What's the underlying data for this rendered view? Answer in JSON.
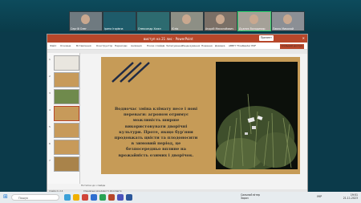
{
  "meeting": {
    "participants": [
      {
        "name": "Сергій Олег"
      },
      {
        "name": "Ірина Ігорівна"
      },
      {
        "name": "Олександр Хижн"
      },
      {
        "name": "Юлія"
      },
      {
        "name": "Андрій Миколайович"
      },
      {
        "name": "Дудник Володимир"
      },
      {
        "name": "Павло Миколай"
      }
    ]
  },
  "powerpoint": {
    "title": "виступ на 21 лис · PowerPoint",
    "share_button": "Спільний доступ",
    "present_label": "Презент",
    "tabs": [
      "Файл",
      "Основне",
      "Вставлення",
      "Конструктор",
      "Переходи",
      "Анімація",
      "Показ слайдів",
      "Записування",
      "Рецензування",
      "Подання",
      "Довідка",
      "ABBYY FineReader PDF"
    ],
    "slide_count_label": "Слайд 4 з 14",
    "status_center": "Спеціальні можливості: Дослідити",
    "notes_placeholder": "Нотатки до слайда",
    "slide": {
      "text": "Водночас зміна клімату несе і нові переваги: агроном отримує можливість ширше використовувати дворічні культури. Проте, якщо бур'яни продовжать цвісти та плодоносити в зимовий період, це безпосередньо вплине на врожайність озимих і дворічок."
    }
  },
  "taskbar": {
    "search_placeholder": "Пошук",
    "weather": "Сильний вітер",
    "weather_sub": "Зараз",
    "lang": "УКР",
    "time": "19:51",
    "date": "21.11.2023"
  }
}
